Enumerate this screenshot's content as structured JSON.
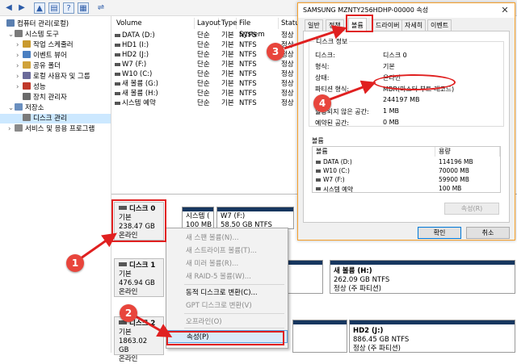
{
  "tree": {
    "items": [
      {
        "label": "컴퓨터 관리(로컬)",
        "indent": 0,
        "expand": ""
      },
      {
        "label": "시스템 도구",
        "indent": 1,
        "expand": "⌄"
      },
      {
        "label": "작업 스케줄러",
        "indent": 2,
        "expand": "›"
      },
      {
        "label": "이벤트 뷰어",
        "indent": 2,
        "expand": "›"
      },
      {
        "label": "공유 폴더",
        "indent": 2,
        "expand": "›"
      },
      {
        "label": "로컬 사용자 및 그룹",
        "indent": 2,
        "expand": "›"
      },
      {
        "label": "성능",
        "indent": 2,
        "expand": "›"
      },
      {
        "label": "장치 관리자",
        "indent": 2,
        "expand": ""
      },
      {
        "label": "저장소",
        "indent": 1,
        "expand": "⌄"
      },
      {
        "label": "디스크 관리",
        "indent": 2,
        "expand": ""
      },
      {
        "label": "서비스 및 응용 프로그램",
        "indent": 1,
        "expand": "›"
      }
    ]
  },
  "volumes": {
    "headers": [
      "Volume",
      "Layout",
      "Type",
      "File System",
      "Status"
    ],
    "rows": [
      [
        "DATA (D:)",
        "단순",
        "기본",
        "NTFS",
        "정상"
      ],
      [
        "HD1 (I:)",
        "단순",
        "기본",
        "NTFS",
        "정상"
      ],
      [
        "HD2 (J:)",
        "단순",
        "기본",
        "NTFS",
        "정상"
      ],
      [
        "W7 (F:)",
        "단순",
        "기본",
        "NTFS",
        "정상"
      ],
      [
        "W10 (C:)",
        "단순",
        "기본",
        "NTFS",
        "정상"
      ],
      [
        "새 볼륨 (G:)",
        "단순",
        "기본",
        "NTFS",
        "정상"
      ],
      [
        "새 볼륨 (H:)",
        "단순",
        "기본",
        "NTFS",
        "정상"
      ],
      [
        "시스템 예약",
        "단순",
        "기본",
        "NTFS",
        "정상"
      ]
    ]
  },
  "disks": [
    {
      "name": "디스크 0",
      "type": "기본",
      "size": "238.47 GB",
      "status": "온라인"
    },
    {
      "name": "디스크 1",
      "type": "기본",
      "size": "476.94 GB",
      "status": "온라인"
    },
    {
      "name": "디스크 2",
      "type": "기본",
      "size": "1863.02 GB",
      "status": "온라인"
    }
  ],
  "partitions": {
    "sys": {
      "name": "시스템 (",
      "size": "100 MB"
    },
    "w7": {
      "name": "W7  (F:)",
      "size": "58.50 GB NTFS"
    },
    "newh": {
      "name": "새 볼륨  (H:)",
      "size": "262.09 GB NTFS",
      "status": "정상 (주 파티션)"
    },
    "hd2": {
      "name": "HD2  (J:)",
      "size": "886.45 GB NTFS",
      "status": "정상 (주 파티션)"
    }
  },
  "context_menu": {
    "items": [
      {
        "label": "새 스팬 볼륨(N)...",
        "disabled": true
      },
      {
        "label": "새 스트라이프 볼륨(T)...",
        "disabled": true
      },
      {
        "label": "새 미러 볼륨(R)...",
        "disabled": true
      },
      {
        "label": "새 RAID-5 볼륨(W)...",
        "disabled": true
      },
      {
        "label": "동적 디스크로 변환(C)...",
        "disabled": false
      },
      {
        "label": "GPT 디스크로 변환(V)",
        "disabled": true
      },
      {
        "label": "오프라인(O)",
        "disabled": true
      },
      {
        "label": "속성(P)",
        "disabled": false
      }
    ]
  },
  "dialog": {
    "title": "SAMSUNG MZNTY256HDHP-00000 속성",
    "close": "✕",
    "tabs": [
      "일반",
      "정책",
      "볼륨",
      "드라이버",
      "자세히",
      "이벤트"
    ],
    "group_title": "디스크 정보",
    "info": [
      {
        "label": "디스크:",
        "value": "디스크 0"
      },
      {
        "label": "형식:",
        "value": "기본"
      },
      {
        "label": "상태:",
        "value": "온라인"
      },
      {
        "label": "파티션 형식:",
        "value": "MBR(마스터 부트 레코드)"
      },
      {
        "label": "",
        "value": "244197 MB"
      },
      {
        "label": "할당되지 않은 공간:",
        "value": "1 MB"
      },
      {
        "label": "예약된 공간:",
        "value": "0 MB"
      }
    ],
    "volumes_label": "볼륨",
    "vol_headers": [
      "볼륨",
      "용량"
    ],
    "vol_rows": [
      [
        "DATA (D:)",
        "114196 MB"
      ],
      [
        "W10 (C:)",
        "70000 MB"
      ],
      [
        "W7 (F:)",
        "59900 MB"
      ],
      [
        "시스템 예약",
        "100 MB"
      ]
    ],
    "properties_button": "속성(R)",
    "ok_button": "확인",
    "cancel_button": "취소"
  },
  "badges": [
    "1",
    "2",
    "3",
    "4"
  ],
  "colors": {
    "annotation": "#e02020",
    "badge": "#e8453c",
    "partition_bar": "#16365f",
    "accent": "#0078d7"
  }
}
